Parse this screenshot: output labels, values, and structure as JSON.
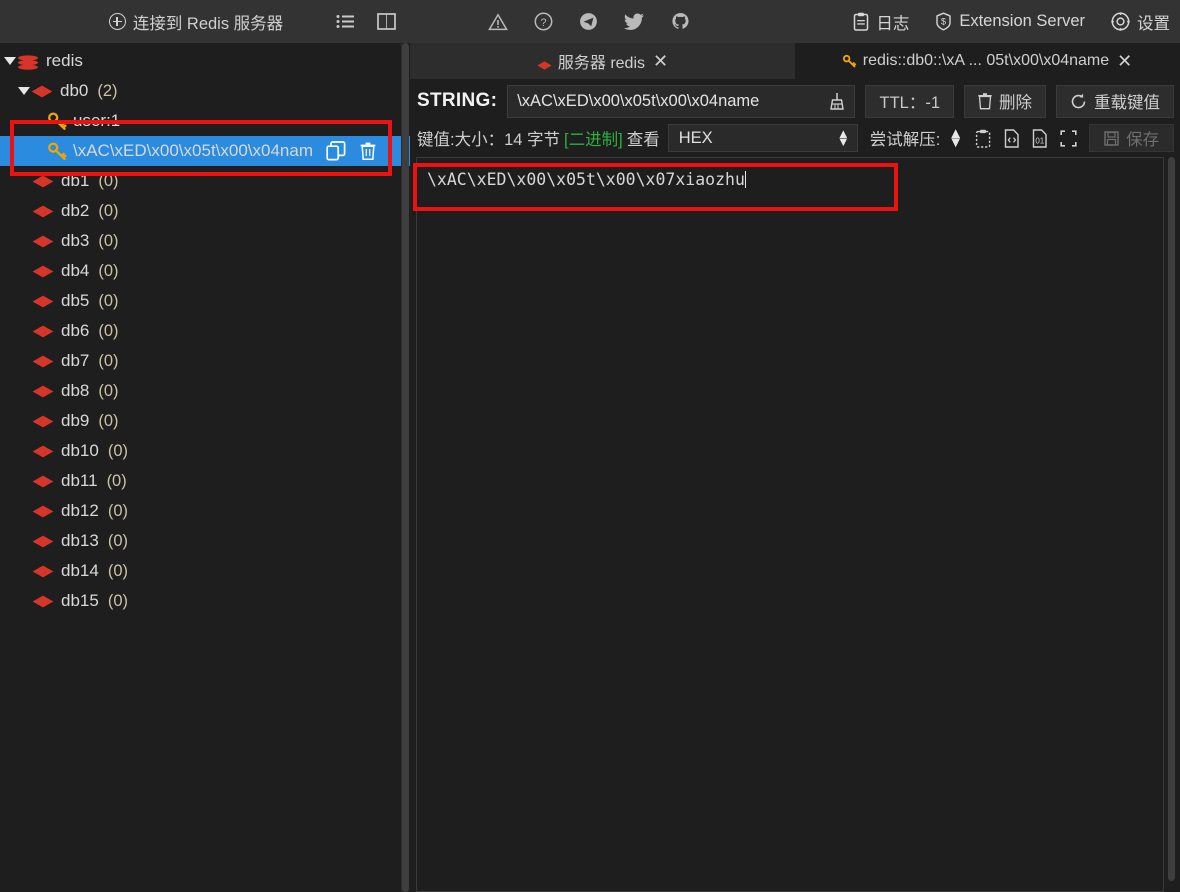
{
  "topbar": {
    "connect_label": "连接到 Redis 服务器",
    "connect_icon": "plus-circle-icon",
    "list_icon": "list-view-icon",
    "split_icon": "split-panel-icon",
    "social": [
      {
        "name": "warning-icon"
      },
      {
        "name": "help-icon"
      },
      {
        "name": "telegram-icon"
      },
      {
        "name": "twitter-icon"
      },
      {
        "name": "github-icon"
      }
    ],
    "log_label": "日志",
    "extension_label": "Extension Server",
    "settings_label": "设置"
  },
  "sidebar": {
    "root": {
      "label": "redis",
      "expanded": true
    },
    "databases": [
      {
        "label": "db0",
        "count": "(2)",
        "expanded": true
      },
      {
        "label": "db1",
        "count": "(0)",
        "expanded": false
      },
      {
        "label": "db2",
        "count": "(0)",
        "expanded": false
      },
      {
        "label": "db3",
        "count": "(0)",
        "expanded": false
      },
      {
        "label": "db4",
        "count": "(0)",
        "expanded": false
      },
      {
        "label": "db5",
        "count": "(0)",
        "expanded": false
      },
      {
        "label": "db6",
        "count": "(0)",
        "expanded": false
      },
      {
        "label": "db7",
        "count": "(0)",
        "expanded": false
      },
      {
        "label": "db8",
        "count": "(0)",
        "expanded": false
      },
      {
        "label": "db9",
        "count": "(0)",
        "expanded": false
      },
      {
        "label": "db10",
        "count": "(0)",
        "expanded": false
      },
      {
        "label": "db11",
        "count": "(0)",
        "expanded": false
      },
      {
        "label": "db12",
        "count": "(0)",
        "expanded": false
      },
      {
        "label": "db13",
        "count": "(0)",
        "expanded": false
      },
      {
        "label": "db14",
        "count": "(0)",
        "expanded": false
      },
      {
        "label": "db15",
        "count": "(0)",
        "expanded": false
      }
    ],
    "keys": [
      {
        "label": "user:1",
        "selected": false
      },
      {
        "label": "\\xAC\\xED\\x00\\x05t\\x00\\x04nam",
        "selected": true
      }
    ],
    "selected_color": "#2a8bdf"
  },
  "tabs": [
    {
      "label": "服务器 redis",
      "icon": "server-dot-icon",
      "active": false,
      "close": "✕"
    },
    {
      "label": "redis::db0::\\xA ... 05t\\x00\\x04name",
      "icon": "key-icon",
      "active": true,
      "close": "✕"
    }
  ],
  "key_row": {
    "type_label": "STRING:",
    "key_value": "\\xAC\\xED\\x00\\x05t\\x00\\x04name",
    "broom_icon": "broom-icon",
    "ttl_label": "TTL：-1",
    "delete_label": "删除",
    "delete_icon": "trash-icon",
    "reload_label": "重载键值",
    "reload_icon": "refresh-icon"
  },
  "meta_row": {
    "prefix": "键值:",
    "size_label": "大小：",
    "size_value": "14 字节",
    "binary_tag": "[二进制]",
    "binary_color": "#2faf3f",
    "view_label": "查看",
    "view_format": "HEX",
    "decompress_label": "尝试解压:",
    "icons": [
      {
        "name": "clipboard-icon"
      },
      {
        "name": "code-file-icon"
      },
      {
        "name": "binary-file-icon"
      },
      {
        "name": "fullscreen-icon"
      }
    ],
    "save_label": "保存",
    "save_icon": "save-disk-icon",
    "save_enabled": false
  },
  "value_editor": {
    "content": "\\xAC\\xED\\x00\\x05t\\x00\\x07xiaozhu"
  },
  "annotations": {
    "color": "#ee1111",
    "boxes": [
      {
        "name": "tree-key-highlight"
      },
      {
        "name": "value-editor-highlight"
      }
    ]
  }
}
